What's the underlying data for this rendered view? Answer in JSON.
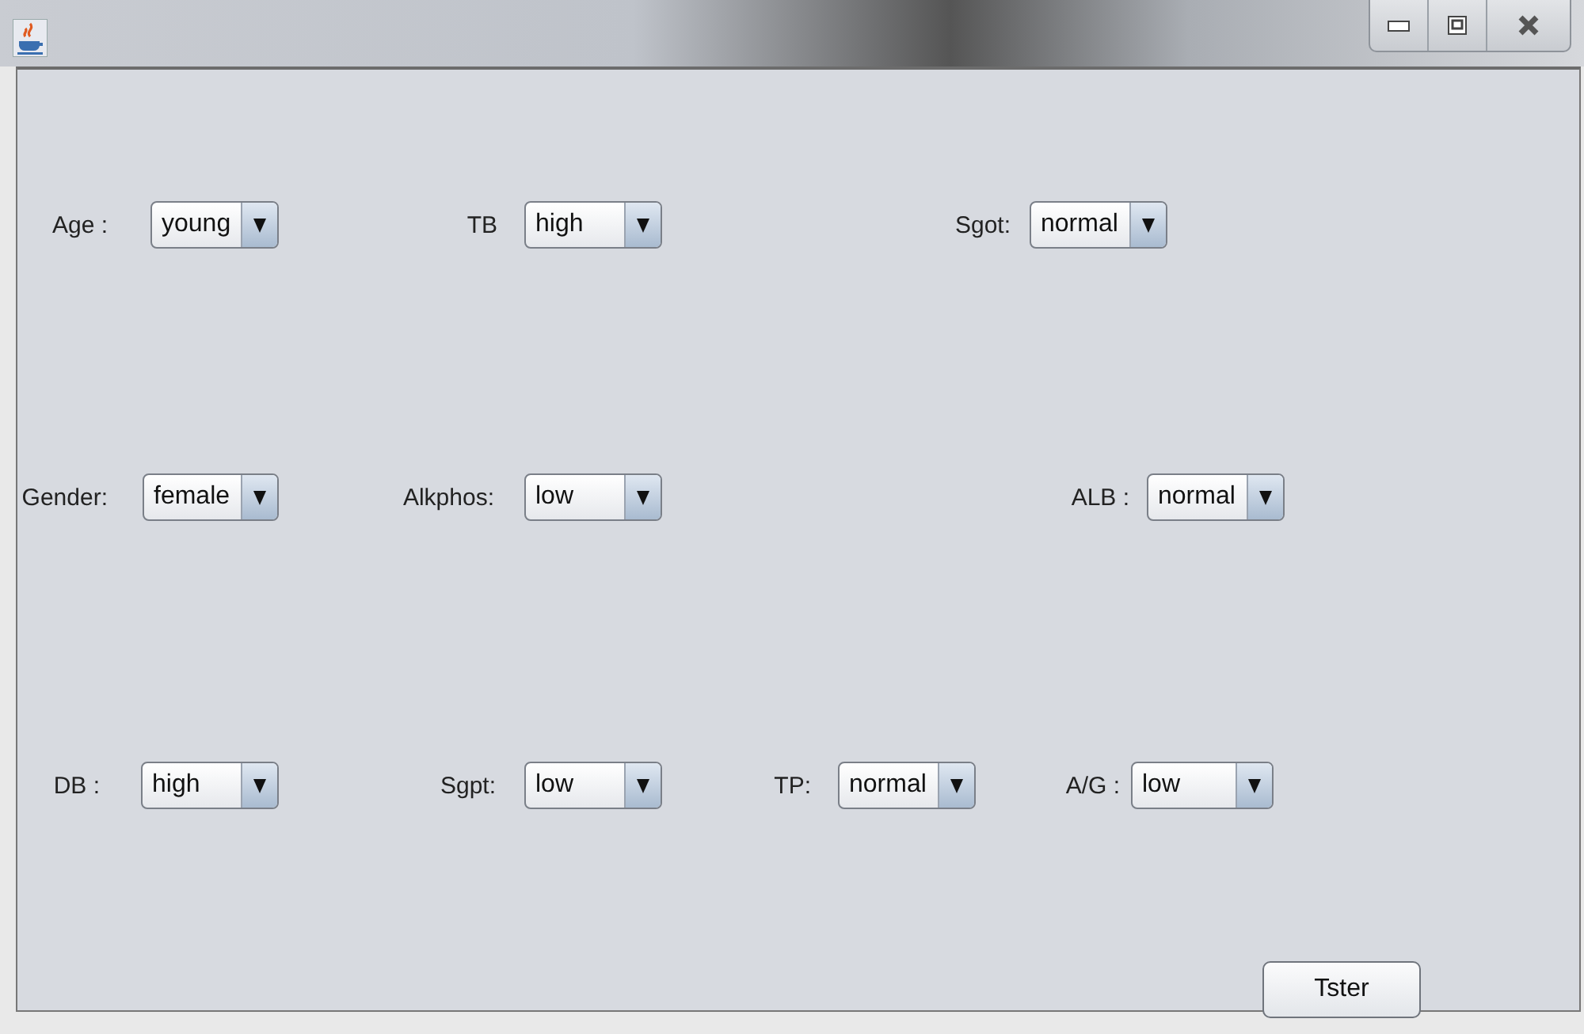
{
  "rows": [
    {
      "fields": [
        {
          "label": "Age :",
          "value": "young"
        },
        {
          "label": "TB",
          "value": "high"
        },
        {
          "label": "Sgot:",
          "value": "normal"
        }
      ]
    },
    {
      "fields": [
        {
          "label": "Gender:",
          "value": "female"
        },
        {
          "label": "Alkphos:",
          "value": "low"
        },
        {
          "label": "ALB :",
          "value": "normal"
        }
      ]
    },
    {
      "fields": [
        {
          "label": "DB :",
          "value": "high"
        },
        {
          "label": "Sgpt:",
          "value": "low"
        },
        {
          "label": "TP:",
          "value": "normal"
        },
        {
          "label": "A/G :",
          "value": "low"
        }
      ]
    }
  ],
  "button": {
    "label": "Tster"
  }
}
